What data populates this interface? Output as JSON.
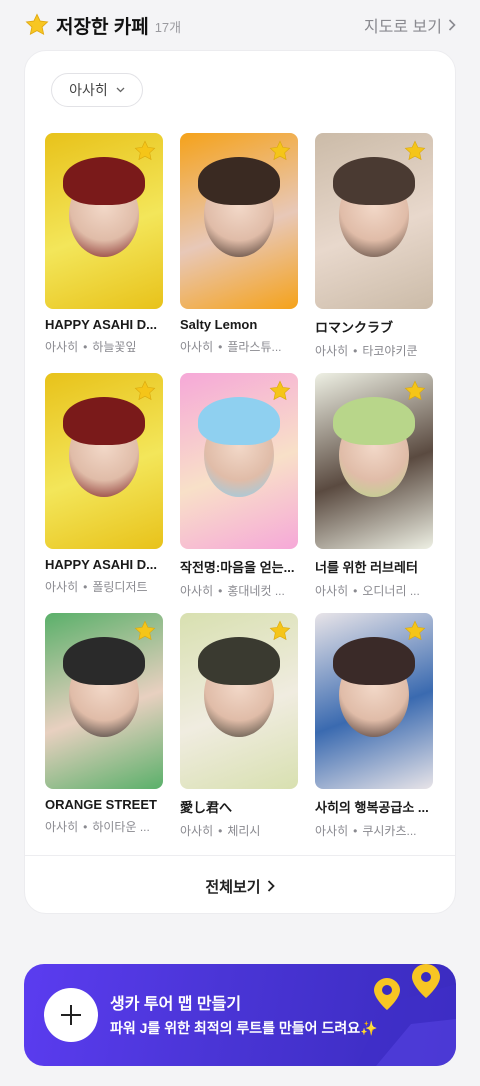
{
  "header": {
    "title": "저장한 카페",
    "count": "17개",
    "map_link": "지도로 보기"
  },
  "filter": {
    "selected": "아사히"
  },
  "cafes": [
    {
      "title": "HAPPY ASAHI D...",
      "artist": "아사히",
      "place": "하늘꽃잎",
      "palette": [
        "#e8c21a",
        "#7a1a1a",
        "#f3e65a"
      ]
    },
    {
      "title": "Salty Lemon",
      "artist": "아사히",
      "place": "플라스튜...",
      "palette": [
        "#f5a21a",
        "#3a2a22",
        "#e8c8b8"
      ]
    },
    {
      "title": "ロマンクラブ",
      "artist": "아사히",
      "place": "타코야키쿤",
      "palette": [
        "#cbbba8",
        "#4a3a32",
        "#e8d8cc"
      ]
    },
    {
      "title": "HAPPY ASAHI D...",
      "artist": "아사히",
      "place": "폴링디저트",
      "palette": [
        "#e8c21a",
        "#7a1a1a",
        "#f3e65a"
      ]
    },
    {
      "title": "작전명:마음을 얻는...",
      "artist": "아사히",
      "place": "홍대네컷 ...",
      "palette": [
        "#f6a8d8",
        "#8fd0f0",
        "#f8e0c8"
      ]
    },
    {
      "title": "너를 위한 러브레터",
      "artist": "아사히",
      "place": "오디너리 ...",
      "palette": [
        "#eef0e4",
        "#b8d68a",
        "#5a4a40"
      ]
    },
    {
      "title": "ORANGE STREET",
      "artist": "아사히",
      "place": "하이타운 ...",
      "palette": [
        "#5ab06a",
        "#2a2a2a",
        "#e8d0c0"
      ]
    },
    {
      "title": "愛し君へ",
      "artist": "아사히",
      "place": "체리시",
      "palette": [
        "#d8e0b0",
        "#3a3a30",
        "#f0ece0"
      ]
    },
    {
      "title": "사히의 행복공급소 ...",
      "artist": "아사히",
      "place": "쿠시카츠...",
      "palette": [
        "#e8e4e8",
        "#3a2a28",
        "#3a6ab0"
      ]
    }
  ],
  "view_all": "전체보기",
  "banner": {
    "title": "생카 투어 맵 만들기",
    "subtitle": "파워 J를 위한 최적의 루트를 만들어 드려요✨"
  },
  "colors": {
    "accent": "#4a35d6",
    "star": "#f5c518"
  }
}
